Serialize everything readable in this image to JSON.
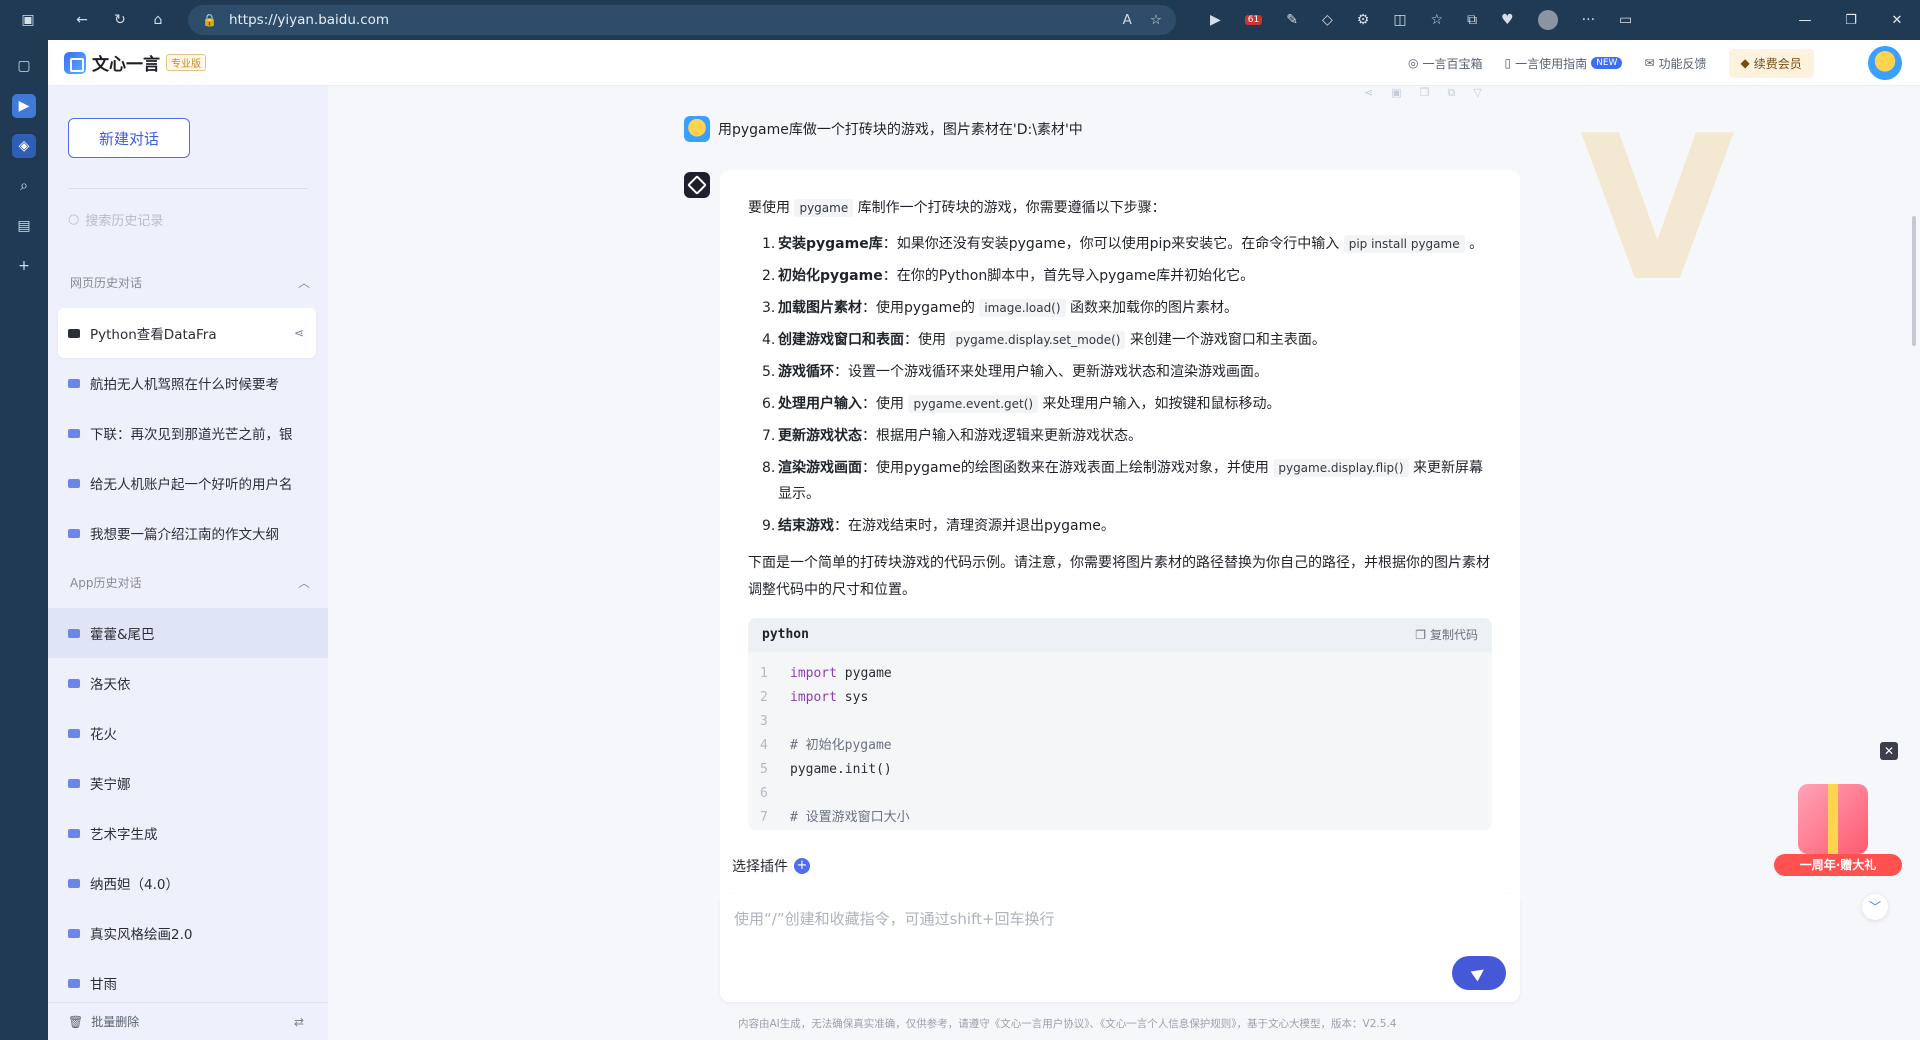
{
  "browser": {
    "url": "https://yiyan.baidu.com",
    "badge_count": "61"
  },
  "header": {
    "app_name": "文心一言",
    "edition_badge": "专业版",
    "links": [
      {
        "label": "一言百宝箱"
      },
      {
        "label": "一言使用指南",
        "tag": "NEW"
      },
      {
        "label": "功能反馈"
      }
    ],
    "renew_label": "续费会员"
  },
  "sidebar": {
    "new_chat_label": "新建对话",
    "search_placeholder": "搜索历史记录",
    "web_section_title": "网页历史对话",
    "web_items": [
      {
        "label": "Python查看DataFra"
      },
      {
        "label": "航拍无人机驾照在什么时候要考"
      },
      {
        "label": "下联：再次见到那道光芒之前，银"
      },
      {
        "label": "给无人机账户起一个好听的用户名"
      },
      {
        "label": "我想要一篇介绍江南的作文大纲"
      }
    ],
    "app_section_title": "App历史对话",
    "app_items": [
      {
        "label": "藿藿&尾巴"
      },
      {
        "label": "洛天依"
      },
      {
        "label": "花火"
      },
      {
        "label": "芙宁娜"
      },
      {
        "label": "艺术字生成"
      },
      {
        "label": "纳西妲（4.0）"
      },
      {
        "label": "真实风格绘画2.0"
      },
      {
        "label": "甘雨"
      }
    ],
    "batch_delete_label": "批量删除"
  },
  "chat": {
    "user_message": "用pygame库做一个打砖块的游戏，图片素材在'D:\\素材'中",
    "answer_intro_pre": "要使用",
    "answer_intro_code": "pygame",
    "answer_intro_post": "库制作一个打砖块的游戏，你需要遵循以下步骤：",
    "steps": [
      {
        "num": "1.",
        "title": "安装pygame库",
        "text": "：如果你还没有安装pygame，你可以使用pip来安装它。在命令行中输入",
        "code": "pip install pygame",
        "tail": "。"
      },
      {
        "num": "2.",
        "title": "初始化pygame",
        "text": "：在你的Python脚本中，首先导入pygame库并初始化它。",
        "code": "",
        "tail": ""
      },
      {
        "num": "3.",
        "title": "加载图片素材",
        "text": "：使用pygame的",
        "code": "image.load()",
        "tail": "函数来加载你的图片素材。"
      },
      {
        "num": "4.",
        "title": "创建游戏窗口和表面",
        "text": "：使用",
        "code": "pygame.display.set_mode()",
        "tail": "来创建一个游戏窗口和主表面。"
      },
      {
        "num": "5.",
        "title": "游戏循环",
        "text": "：设置一个游戏循环来处理用户输入、更新游戏状态和渲染游戏画面。",
        "code": "",
        "tail": ""
      },
      {
        "num": "6.",
        "title": "处理用户输入",
        "text": "：使用",
        "code": "pygame.event.get()",
        "tail": "来处理用户输入，如按键和鼠标移动。"
      },
      {
        "num": "7.",
        "title": "更新游戏状态",
        "text": "：根据用户输入和游戏逻辑来更新游戏状态。",
        "code": "",
        "tail": ""
      },
      {
        "num": "8.",
        "title": "渲染游戏画面",
        "text": "：使用pygame的绘图函数来在游戏表面上绘制游戏对象，并使用",
        "code": "pygame.display.flip()",
        "tail": "来更新屏幕显示。"
      },
      {
        "num": "9.",
        "title": "结束游戏",
        "text": "：在游戏结束时，清理资源并退出pygame。",
        "code": "",
        "tail": ""
      }
    ],
    "intro2": "下面是一个简单的打砖块游戏的代码示例。请注意，你需要将图片素材的路径替换为你自己的路径，并根据你的图片素材调整代码中的尺寸和位置。",
    "code_lang": "python",
    "copy_label": "复制代码",
    "code_lines": [
      {
        "n": "1",
        "kw": "import",
        "text": " pygame",
        "comment": ""
      },
      {
        "n": "2",
        "kw": "import",
        "text": " sys",
        "comment": ""
      },
      {
        "n": "3",
        "kw": "",
        "text": "",
        "comment": ""
      },
      {
        "n": "4",
        "kw": "",
        "text": "",
        "comment": "# 初始化pygame"
      },
      {
        "n": "5",
        "kw": "",
        "text": "pygame.init()",
        "comment": ""
      },
      {
        "n": "6",
        "kw": "",
        "text": "",
        "comment": ""
      },
      {
        "n": "7",
        "kw": "",
        "text": "",
        "comment": "# 设置游戏窗口大小"
      }
    ]
  },
  "composer": {
    "plugin_label": "选择插件",
    "placeholder": "使用“/”创建和收藏指令，可通过shift+回车换行"
  },
  "footer": {
    "disclaimer": "内容由AI生成，无法确保真实准确，仅供参考，请遵守《文心一言用户协议》、《文心一言个人信息保护规则》，基于文心大模型，版本：V2.5.4"
  },
  "promo": {
    "label": "一周年·赠大礼"
  }
}
